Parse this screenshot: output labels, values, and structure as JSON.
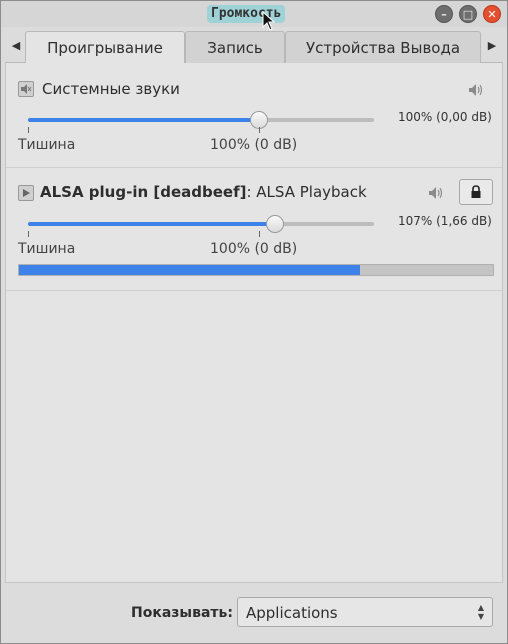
{
  "window": {
    "title": "Громкость",
    "min_label": "–",
    "max_label": "□",
    "close_label": "✕"
  },
  "tabs": [
    {
      "label": "Проигрывание",
      "active": true
    },
    {
      "label": "Запись",
      "active": false
    },
    {
      "label": "Устройства Вывода",
      "active": false
    }
  ],
  "tab_scroll_left": "◀",
  "tab_scroll_right": "▶",
  "streams": [
    {
      "name": "Системные звуки",
      "name_bold": "",
      "name_suffix": "",
      "icon": "muted-speaker-icon",
      "volume_percent": 100,
      "volume_label": "100% (0,00 dB)",
      "mark_min_label": "Тишина",
      "mark_100_label": "100% (0 dB)",
      "has_lock": false,
      "has_meter": false
    },
    {
      "name": "",
      "name_bold": "ALSA plug-in [deadbeef]",
      "name_suffix": ": ALSA Playback",
      "icon": "play-app-icon",
      "volume_percent": 107,
      "volume_label": "107% (1,66 dB)",
      "mark_min_label": "Тишина",
      "mark_100_label": "100% (0 dB)",
      "has_lock": true,
      "has_meter": true,
      "meter_level": 0.72
    }
  ],
  "footer": {
    "show_label": "Показывать:",
    "show_value": "Applications"
  },
  "colors": {
    "accent": "#3c82e8",
    "close_button": "#e4502f",
    "title_highlight": "#9fd2d6"
  }
}
